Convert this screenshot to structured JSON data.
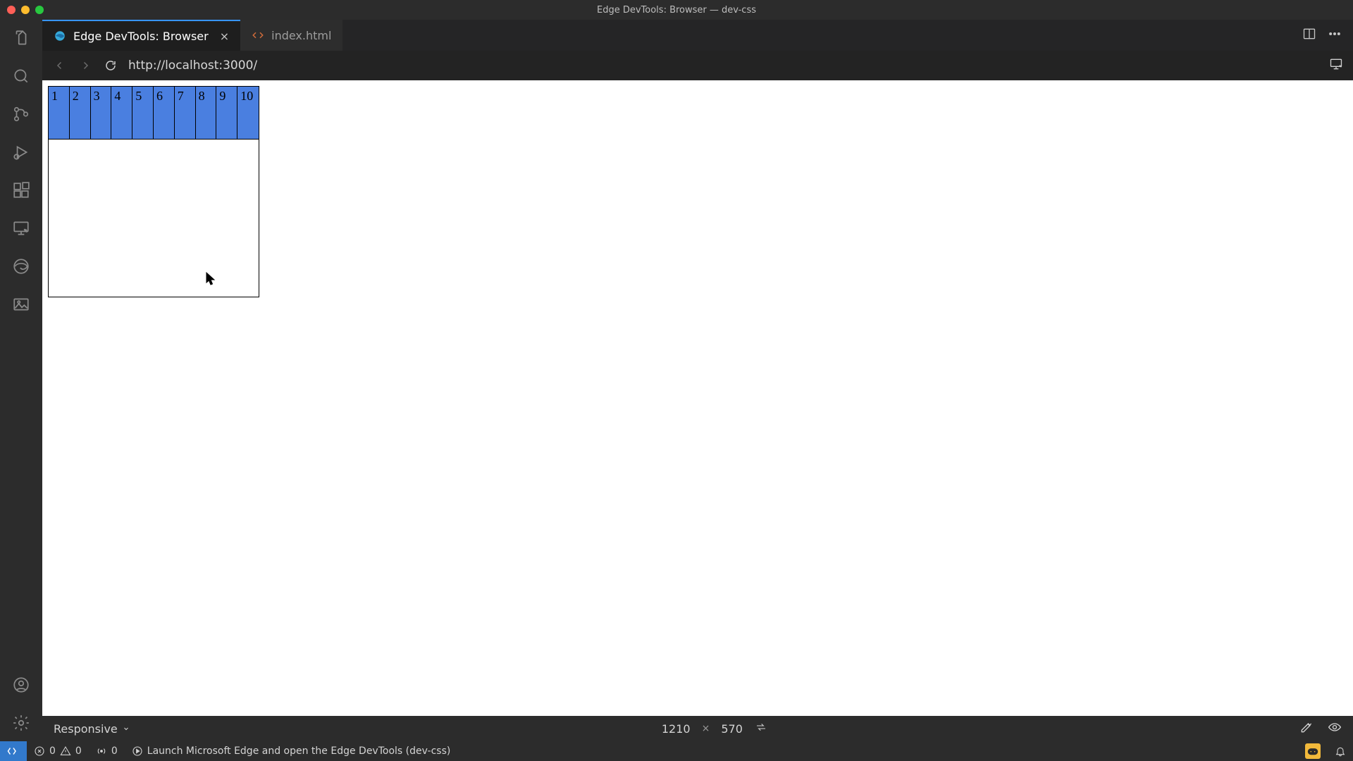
{
  "window": {
    "title": "Edge DevTools: Browser — dev-css"
  },
  "tabs": {
    "active": {
      "label": "Edge DevTools: Browser"
    },
    "other": {
      "label": "index.html"
    }
  },
  "browser": {
    "url": "http://localhost:3000/"
  },
  "page": {
    "cells": [
      "1",
      "2",
      "3",
      "4",
      "5",
      "6",
      "7",
      "8",
      "9",
      "10"
    ]
  },
  "device": {
    "mode": "Responsive",
    "width": "1210",
    "height": "570",
    "separator": "×"
  },
  "status": {
    "errors": "0",
    "warnings": "0",
    "ports": "0",
    "launch": "Launch Microsoft Edge and open the Edge DevTools (dev-css)"
  }
}
